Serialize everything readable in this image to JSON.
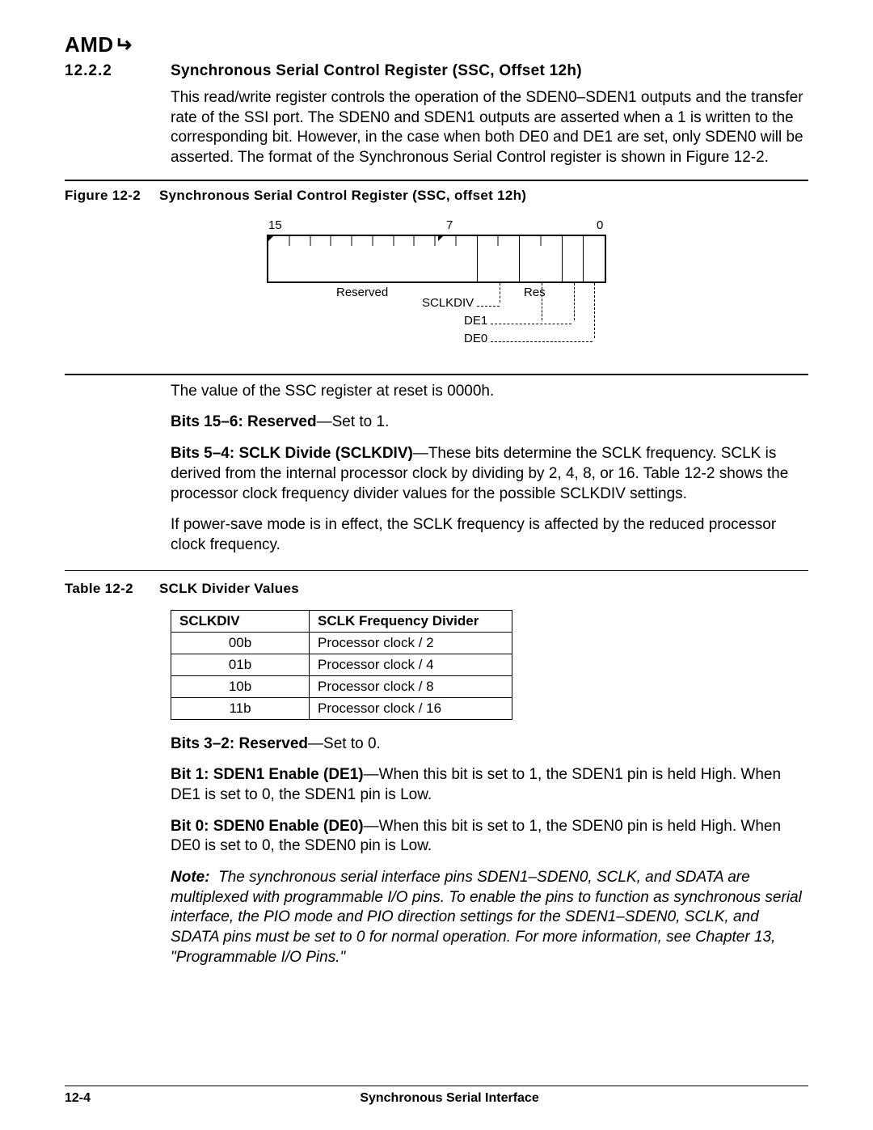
{
  "logo": "AMD",
  "section_number": "12.2.2",
  "section_title": "Synchronous Serial Control Register (SSC, Offset 12h)",
  "intro_paragraph": "This read/write register controls the operation of the SDEN0–SDEN1 outputs and the transfer rate of the SSI port. The SDEN0 and SDEN1 outputs are asserted when a 1 is written to the corresponding bit. However, in the case when both DE0 and DE1 are set, only SDEN0 will be asserted. The format of the Synchronous Serial Control register is shown in Figure 12-2.",
  "figure_label": "Figure 12-2",
  "figure_title": "Synchronous Serial Control Register (SSC, offset 12h)",
  "register": {
    "bit_hi": "15",
    "bit_mid": "7",
    "bit_lo": "0",
    "field_reserved_hi": "Reserved",
    "field_res_lo": "Res",
    "field_sclkdiv": "SCLKDIV",
    "field_de1": "DE1",
    "field_de0": "DE0"
  },
  "reset_text": "The value of the SSC register at reset is 0000h.",
  "bits_15_6_label": "Bits 15–6: Reserved",
  "bits_15_6_text": "—Set to 1.",
  "bits_5_4_label": "Bits 5–4: SCLK Divide (SCLKDIV)",
  "bits_5_4_text": "—These bits determine the SCLK frequency. SCLK is derived from the internal processor clock by dividing by 2, 4, 8, or 16. Table 12-2 shows the processor clock frequency divider values for the possible SCLKDIV settings.",
  "power_save_text": "If power-save mode is in effect, the SCLK frequency is affected by the reduced processor clock frequency.",
  "table_label": "Table 12-2",
  "table_title": "SCLK Divider Values",
  "table_headers": {
    "c1": "SCLKDIV",
    "c2": "SCLK Frequency Divider"
  },
  "table_rows": [
    {
      "c1": "00b",
      "c2": "Processor clock / 2"
    },
    {
      "c1": "01b",
      "c2": "Processor clock / 4"
    },
    {
      "c1": "10b",
      "c2": "Processor clock / 8"
    },
    {
      "c1": "11b",
      "c2": "Processor clock / 16"
    }
  ],
  "bits_3_2_label": "Bits 3–2: Reserved",
  "bits_3_2_text": "—Set to 0.",
  "bit_1_label": "Bit 1: SDEN1 Enable (DE1)",
  "bit_1_text": "—When this bit is set to 1, the SDEN1 pin is held High. When DE1 is set to 0, the SDEN1 pin is Low.",
  "bit_0_label": "Bit 0: SDEN0 Enable (DE0)",
  "bit_0_text": "—When this bit is set to 1, the SDEN0 pin is held High. When DE0 is set to 0, the SDEN0 pin is Low.",
  "note_label": "Note:",
  "note_text": "The synchronous serial interface pins SDEN1–SDEN0, SCLK, and SDATA are multiplexed with programmable I/O pins. To enable the pins to function as synchronous serial interface, the PIO mode and PIO direction settings for the SDEN1–SDEN0, SCLK, and SDATA pins must be set to 0 for normal operation. For more information, see Chapter 13, \"Programmable I/O Pins.\"",
  "footer_page": "12-4",
  "footer_title": "Synchronous Serial Interface"
}
